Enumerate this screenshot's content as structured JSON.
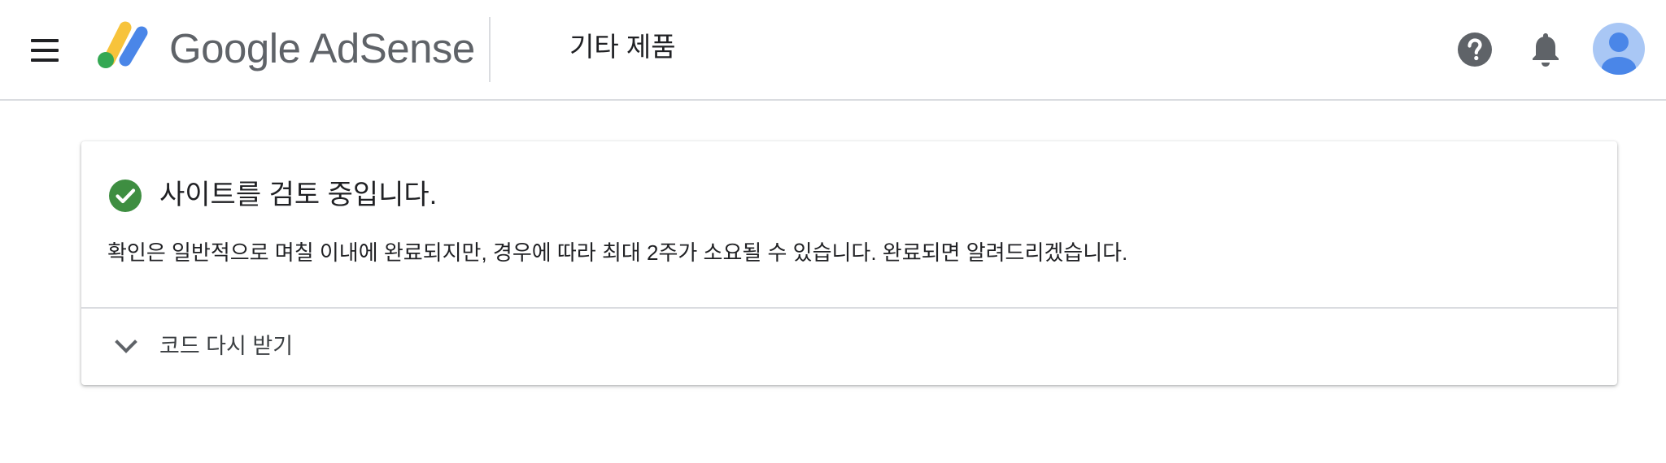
{
  "header": {
    "brand": "Google AdSense",
    "page_title": "기타 제품",
    "icons": {
      "menu": "hamburger-menu-icon",
      "logo": "adsense-logo",
      "help": "help-icon",
      "notifications": "bell-icon",
      "account": "account-avatar-icon"
    }
  },
  "review_card": {
    "title": "사이트를 검토 중입니다.",
    "description": "확인은 일반적으로 며칠 이내에 완료되지만, 경우에 따라 최대 2주가 소요될 수 있습니다. 완료되면 알려드리겠습니다.",
    "status_icon": "check-circle-icon",
    "expand_label": "코드 다시 받기",
    "expand_icon": "chevron-down-icon"
  },
  "colors": {
    "status_green": "#3e8e41",
    "logo_yellow": "#f7c33b",
    "logo_blue": "#4a86e8",
    "logo_green": "#34a853",
    "icon_gray": "#5f6368",
    "avatar_bg": "#a9c7f5",
    "avatar_fg": "#4a86e8"
  }
}
